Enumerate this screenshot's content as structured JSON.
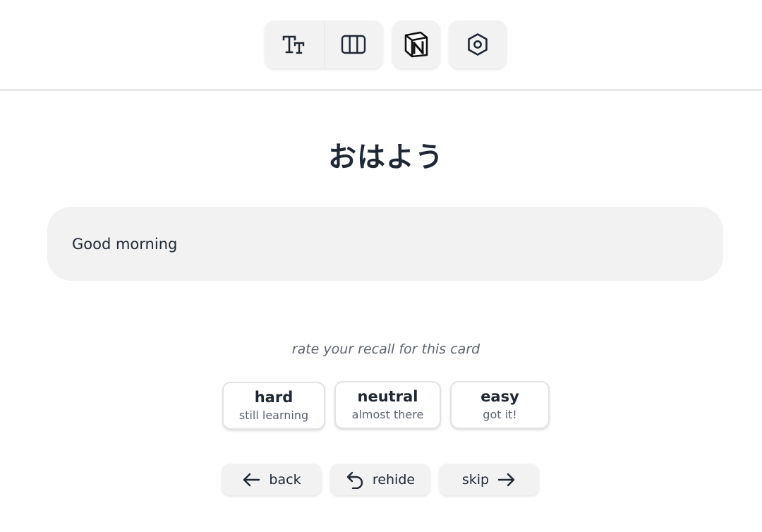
{
  "card": {
    "term": "おはよう",
    "answer": "Good morning"
  },
  "rating": {
    "prompt": "rate your recall for this card",
    "options": [
      {
        "label": "hard",
        "sub": "still learning"
      },
      {
        "label": "neutral",
        "sub": "almost there"
      },
      {
        "label": "easy",
        "sub": "got it!"
      }
    ]
  },
  "nav": {
    "back": "back",
    "rehide": "rehide",
    "skip": "skip"
  },
  "icons": {
    "toolbar": [
      "font-size-icon",
      "columns-icon",
      "notion-icon",
      "settings-icon"
    ],
    "nav": [
      "arrow-left-icon",
      "undo-icon",
      "arrow-right-icon"
    ]
  },
  "colors": {
    "text": "#1f2733",
    "muted": "#5c636e",
    "surface": "#f2f2f3",
    "divider": "#e6e7e9"
  }
}
